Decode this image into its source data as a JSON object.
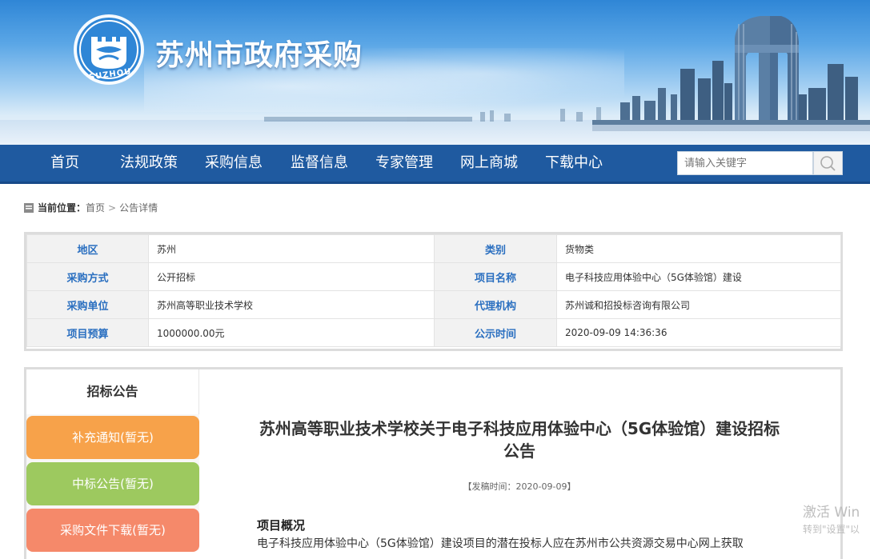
{
  "header": {
    "site_title": "苏州市政府采购",
    "logo_text": "SUZHOU"
  },
  "nav": {
    "items": [
      "首页",
      "法规政策",
      "采购信息",
      "监督信息",
      "专家管理",
      "网上商城",
      "下载中心"
    ],
    "search_placeholder": "请输入关键字"
  },
  "breadcrumb": {
    "label": "当前位置：",
    "items": [
      "首页",
      "公告详情"
    ],
    "separator": ">"
  },
  "info_table": {
    "rows": [
      {
        "k1": "地区",
        "v1": "苏州",
        "k2": "类别",
        "v2": "货物类"
      },
      {
        "k1": "采购方式",
        "v1": "公开招标",
        "k2": "项目名称",
        "v2": "电子科技应用体验中心（5G体验馆）建设"
      },
      {
        "k1": "采购单位",
        "v1": "苏州高等职业技术学校",
        "k2": "代理机构",
        "v2": "苏州诚和招投标咨询有限公司"
      },
      {
        "k1": "项目预算",
        "v1": "1000000.00元",
        "k2": "公示时间",
        "v2": "2020-09-09 14:36:36"
      }
    ]
  },
  "side_tabs": {
    "active": "招标公告",
    "items": [
      {
        "label": "补充通知(暂无)",
        "color": "#f7a24a"
      },
      {
        "label": "中标公告(暂无)",
        "color": "#9dc95f"
      },
      {
        "label": "采购文件下载(暂无)",
        "color": "#f5896a"
      }
    ]
  },
  "article": {
    "title_line1": "苏州高等职业技术学校关于电子科技应用体验中心（5G体验馆）建设招标",
    "title_line2": "公告",
    "date": "【发稿时间：2020-09-09】",
    "section_title": "项目概况",
    "section_text": "电子科技应用体验中心（5G体验馆）建设项目的潜在投标人应在苏州市公共资源交易中心网上获取"
  },
  "watermark": {
    "line1": "激活 Win",
    "line2": "转到\"设置\"以"
  },
  "colors": {
    "nav_bg": "#1f5aa0",
    "label_blue": "#2a6fc0"
  }
}
